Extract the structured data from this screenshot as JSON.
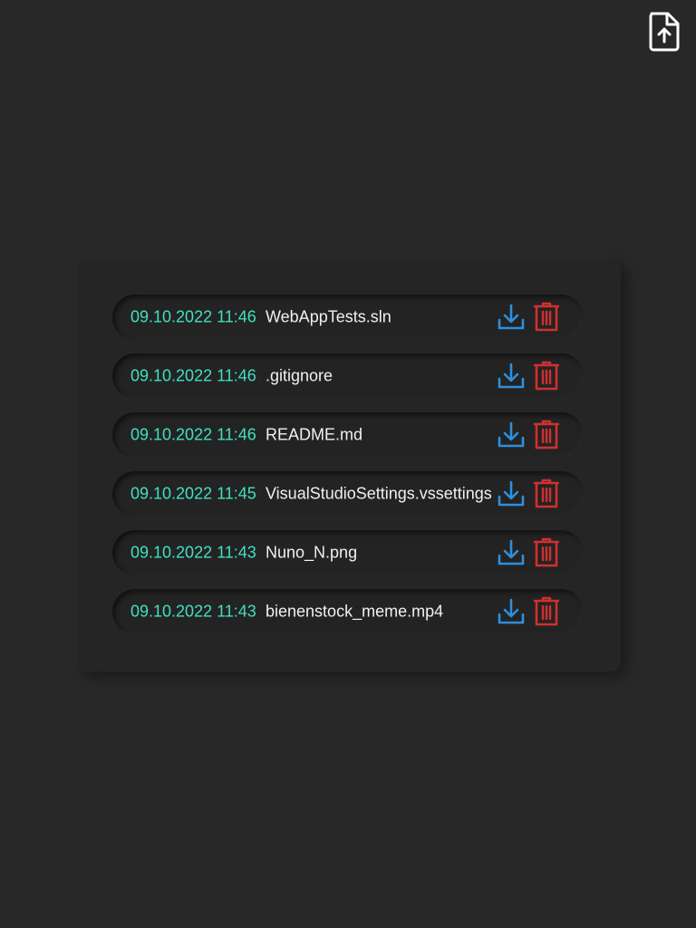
{
  "header": {
    "upload_icon": "file-upload-icon"
  },
  "colors": {
    "background": "#282828",
    "panel": "#252525",
    "date_text": "#40e0c0",
    "name_text": "#f0f0f0",
    "download": "#2e8fdc",
    "delete": "#d03030"
  },
  "files": [
    {
      "date": "09.10.2022 11:46",
      "name": "WebAppTests.sln"
    },
    {
      "date": "09.10.2022 11:46",
      "name": ".gitignore"
    },
    {
      "date": "09.10.2022 11:46",
      "name": "README.md"
    },
    {
      "date": "09.10.2022 11:45",
      "name": "VisualStudioSettings.vssettings"
    },
    {
      "date": "09.10.2022 11:43",
      "name": "Nuno_N.png"
    },
    {
      "date": "09.10.2022 11:43",
      "name": "bienenstock_meme.mp4"
    }
  ],
  "icons": {
    "download": "download-icon",
    "delete": "trash-icon"
  }
}
